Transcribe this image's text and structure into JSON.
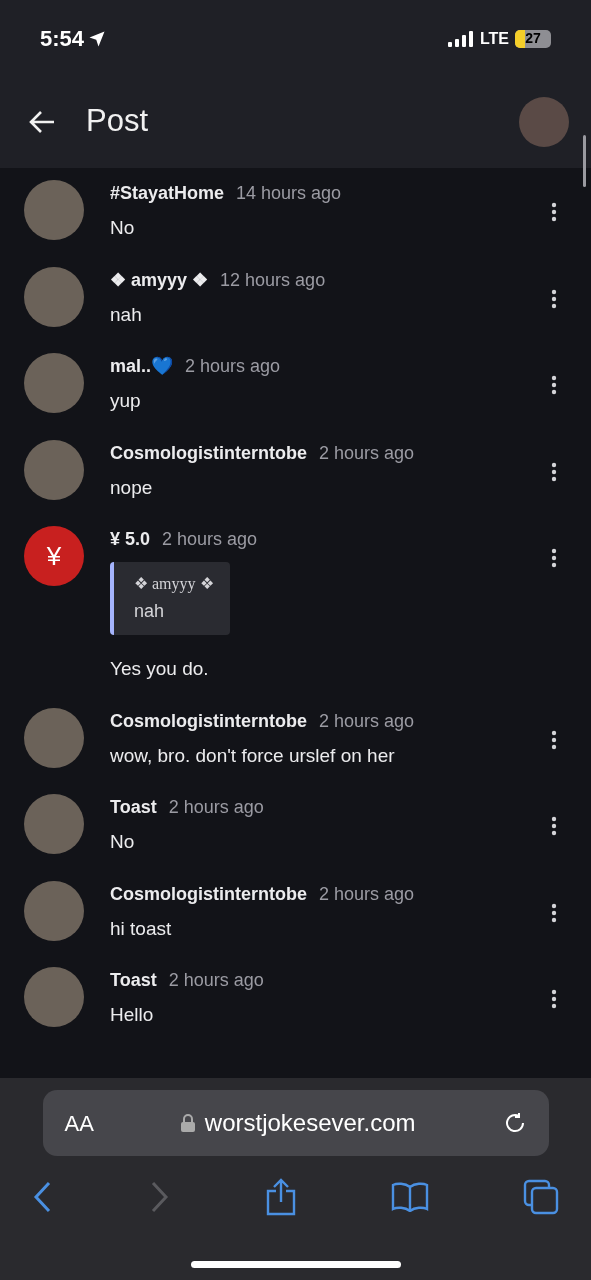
{
  "status_bar": {
    "time": "5:54",
    "network": "LTE",
    "battery": "27",
    "battery_level": {
      "level": 0.27
    }
  },
  "header": {
    "title": "Post"
  },
  "comments": [
    {
      "kind": "photo",
      "author": "#StayatHome",
      "time": "14 hours ago",
      "text": "No"
    },
    {
      "kind": "photo",
      "author": "❖ amyyy ❖",
      "time": "12 hours ago",
      "text": "nah"
    },
    {
      "kind": "photo",
      "author": "mal..💙",
      "time": "2 hours ago",
      "text": "yup"
    },
    {
      "kind": "photo",
      "author": "Cosmologistinterntobe",
      "time": "2 hours ago",
      "text": "nope"
    },
    {
      "kind": "symbol",
      "avatar_text": "¥",
      "author": "¥ 5.0",
      "time": "2 hours ago",
      "quote": {
        "author": "❖ amyyy ❖",
        "text": "nah"
      },
      "text": "Yes you do."
    },
    {
      "kind": "photo",
      "author": "Cosmologistinterntobe",
      "time": "2 hours ago",
      "text": "wow, bro. don't force urslef on her"
    },
    {
      "kind": "photo",
      "author": "Toast",
      "time": "2 hours ago",
      "text": "No"
    },
    {
      "kind": "photo",
      "author": "Cosmologistinterntobe",
      "time": "2 hours ago",
      "text": "hi toast"
    },
    {
      "kind": "photo",
      "author": "Toast",
      "time": "2 hours ago",
      "text": "Hello"
    }
  ],
  "browser": {
    "text_size": "AA",
    "url": "worstjokesever.com"
  }
}
